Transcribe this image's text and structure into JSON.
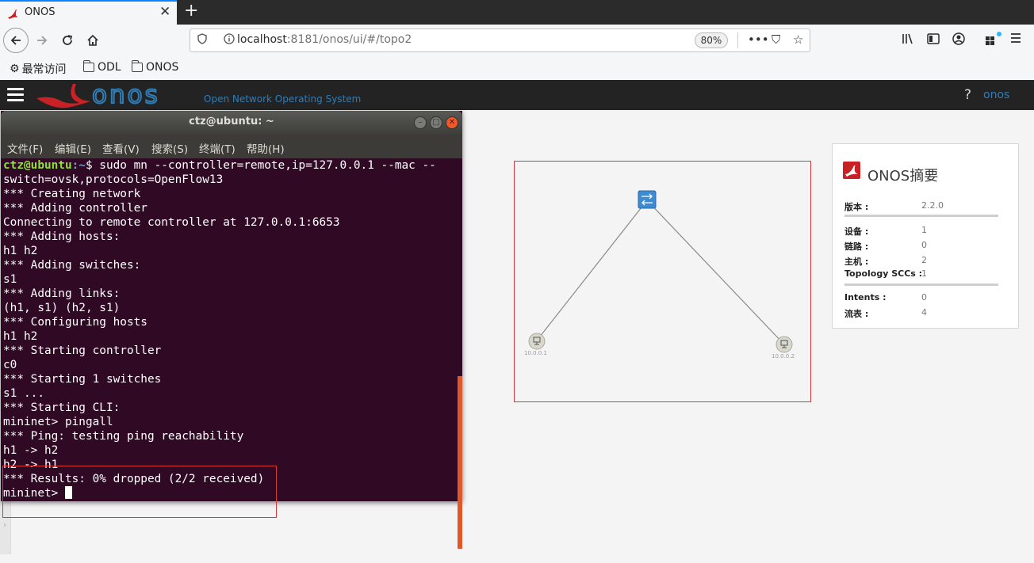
{
  "browser": {
    "tab_title": "ONOS",
    "tab_close": "✕",
    "new_tab": "+",
    "url_host": "localhost",
    "url_rest": ":8181/onos/ui/#/topo2",
    "zoom": "80%",
    "url_actions": [
      "•••",
      "⛉",
      "☆"
    ],
    "bookmarks": [
      "最常访问",
      "ODL",
      "ONOS"
    ]
  },
  "onos": {
    "subtitle": "Open Network Operating System",
    "help": "?",
    "user": "onos"
  },
  "terminal": {
    "title": "ctz@ubuntu: ~",
    "menu": [
      "文件(F)",
      "编辑(E)",
      "查看(V)",
      "搜索(S)",
      "终端(T)",
      "帮助(H)"
    ],
    "prompt_user": "ctz@ubuntu",
    "prompt_path": ":~",
    "first_command": "$ sudo mn --controller=remote,ip=127.0.0.1 --mac --",
    "lines": [
      "switch=ovsk,protocols=OpenFlow13",
      "*** Creating network",
      "*** Adding controller",
      "Connecting to remote controller at 127.0.0.1:6653",
      "*** Adding hosts:",
      "h1 h2",
      "*** Adding switches:",
      "s1",
      "*** Adding links:",
      "(h1, s1) (h2, s1)",
      "*** Configuring hosts",
      "h1 h2",
      "*** Starting controller",
      "c0",
      "*** Starting 1 switches",
      "s1 ...",
      "*** Starting CLI:",
      "mininet> pingall",
      "*** Ping: testing ping reachability",
      "h1 -> h2",
      "h2 -> h1",
      "*** Results: 0% dropped (2/2 received)"
    ],
    "final_prompt": "mininet> "
  },
  "topology": {
    "host1_label": "10.0.0.1",
    "host2_label": "10.0.0.2"
  },
  "summary": {
    "title": "ONOS摘要",
    "version_label": "版本 :",
    "version_value": "2.2.0",
    "devices_label": "设备 :",
    "devices_value": "1",
    "links_label": "链路 :",
    "links_value": "0",
    "hosts_label": "主机 :",
    "hosts_value": "2",
    "sccs_label": "Topology SCCs :",
    "sccs_value": "1",
    "intents_label": "Intents :",
    "intents_value": "0",
    "flows_label": "流表 :",
    "flows_value": "4"
  }
}
